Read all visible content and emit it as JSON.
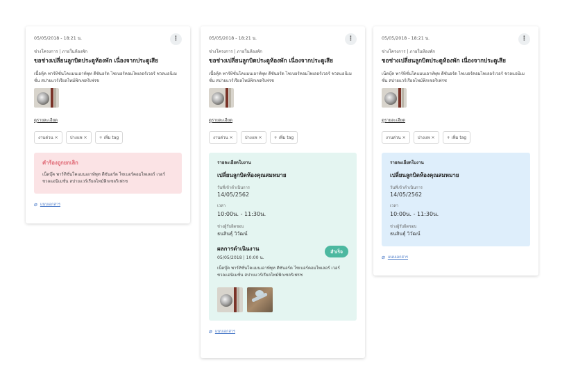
{
  "cards": [
    {
      "timestamp": "05/05/2018 - 18:21 น.",
      "category": "ช่างโครงการ | ภายในห้องพัก",
      "title": "ขอช่างเปลี่ยนลูกบิดประตูห้องพัก เนื่องจากประตูเสีย",
      "description": "เนื้อหุ้ค พาร์ทิชั่นโคแมนเอาท์พุท ดีซันอร์ด ไซเบอร์คอมไพเลอร์เวอร์ ชวลแอนิเมชั่น สปายแวร์เรียลไทม์พิกเซลริเฟรช",
      "detail_link": "ดูรายละเอียด",
      "tags": [
        "งานด่วน ×",
        "ปางแพ ×",
        "+ เพิ่ม tag"
      ],
      "cancel_panel": {
        "title": "คำร้องถูกยกเลิก",
        "text": "เน็ตบุ๊ค พาร์ทิชั่นโคแมนเอาท์พุท ดีซันอร์ด ไซเบอร์คอมไพเลอร์ เวอร์ ชวลแอนิเมชั่น สปายแวร์เรียลไทม์พิกเซลริเฟรช"
      },
      "attach_label": "แนบเอกสาร"
    },
    {
      "timestamp": "05/05/2018 - 18:21 น.",
      "category": "ช่างโครงการ | ภายในห้องพัก",
      "title": "ขอช่างเปลี่ยนลูกบิดประตูห้องพัก เนื่องจากประตูเสีย",
      "description": "เนื้อหุ้ค พาร์ทิชั่นโคแมนเอาท์พุท ดีซันอร์ด ไซเบอร์คอมไพเลอร์เวอร์ ชวลแอนิเมชั่น สปายแวร์เรียลไทม์พิกเซลริเฟรช",
      "detail_link": "ดูรายละเอียด",
      "tags": [
        "งานด่วน ×",
        "ปางแพ ×",
        "+ เพิ่ม tag"
      ],
      "job": {
        "header": "รายละเอียดใบงาน",
        "title": "เปลี่ยนลูกบิดห้องคุณสมหมาย",
        "date_label": "วันที่เข้าดำเนินการ",
        "date_value": "14/05/2562",
        "time_label": "เวลา",
        "time_value": "10:00น. - 11:30น.",
        "tech_label": "ช่างผู้รับผิดชอบ",
        "tech_value": "ธนสินธุ์ วิวัฒน์"
      },
      "result": {
        "title": "ผลการดำเนินงาน",
        "date": "05/05/2018 | 10:00 น.",
        "badge": "สำเร็จ",
        "text": "เน็ตบุ๊ค พาร์ทิชั่นโคแมนเอาท์พุท ดีซันอร์ด ไซเบอร์คอมไพเลอร์ เวอร์ ชวลแอนิเมชั่น สปายแวร์เรียลไทม์พิกเซลริเฟรช"
      },
      "attach_label": "แนบเอกสาร"
    },
    {
      "timestamp": "05/05/2018 - 18:21 น.",
      "category": "ช่างโครงการ | ภายในห้องพัก",
      "title": "ขอช่างเปลี่ยนลูกบิดประตูห้องพัก เนื่องจากประตูเสีย",
      "description": "เน็ตบุ๊ค พาร์ทิชั่นโคแมนเอาท์พุท ดีซันอร์ด ไซเบอร์คอมไพเลอร์เวอร์ ชวลแอนิเมชั่น สปายแวร์เรียลไทม์พิกเซลริเฟรช",
      "detail_link": "ดูรายละเอียด",
      "tags": [
        "งานด่วน ×",
        "ปางแพ ×",
        "+ เพิ่ม tag"
      ],
      "job": {
        "header": "รายละเอียดใบงาน",
        "title": "เปลี่ยนลูกบิดห้องคุณสมหมาย",
        "date_label": "วันที่เข้าดำเนินการ",
        "date_value": "14/05/2562",
        "time_label": "เวลา",
        "time_value": "10:00น. - 11:30น.",
        "tech_label": "ช่างผู้รับผิดชอบ",
        "tech_value": "ธนสินธุ์ วิวัฒน์"
      },
      "attach_label": "แนบเอกสาร"
    }
  ],
  "colors": {
    "cancel_bg": "#fbe3e5",
    "cancel_title": "#e06a76",
    "result_bg": "#e4f5f1",
    "success_badge": "#4cb8a0",
    "job_bg": "#deeefb",
    "attach_link": "#4a7ac8"
  },
  "icons": [
    "more-vert-icon",
    "paperclip-icon",
    "door-knob-photo"
  ]
}
